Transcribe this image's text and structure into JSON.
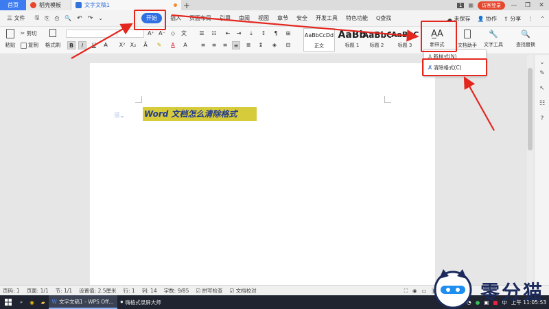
{
  "tabs": {
    "home": "首页",
    "template": "稻壳模板",
    "document": "文字文稿1",
    "new_tab": "+"
  },
  "titlebar": {
    "badge": "1",
    "visitor": "访客登录"
  },
  "menu": {
    "file": "三 文件",
    "items": [
      "开始",
      "插入",
      "页面布局",
      "引用",
      "审阅",
      "视图",
      "章节",
      "安全",
      "开发工具",
      "特色功能"
    ],
    "search": "Q查找",
    "unsaved": "未保存",
    "collab": "协作",
    "share": "分享"
  },
  "ribbon": {
    "paste": "粘贴",
    "cut": "剪切",
    "copy": "复制",
    "format_painter": "格式刷",
    "bold": "B",
    "italic": "I",
    "underline": "U",
    "font_color": "A",
    "styles": [
      {
        "preview": "AaBbCcDd",
        "label": "正文"
      },
      {
        "preview": "AaBb",
        "label": "标题 1"
      },
      {
        "preview": "AaBbC",
        "label": "标题 2"
      },
      {
        "preview": "AaBbC",
        "label": "标题 3"
      }
    ],
    "new_style": "新样式",
    "doc_assistant": "文档助手",
    "word_tools": "文字工具",
    "find_replace": "查找替换"
  },
  "dropdown": {
    "new_style_item": "新样式(N)",
    "clear_format_item": "清除格式(C)"
  },
  "document": {
    "title": "Word 文档怎么清除格式"
  },
  "statusbar": {
    "page_no": "页码: 1",
    "pages": "页面: 1/1",
    "section": "节: 1/1",
    "setting": "设置值: 2.5厘米",
    "row": "行: 1",
    "col": "列: 14",
    "words": "字数: 9/85",
    "spellcheck": "拼写检查",
    "proofread": "文档校对"
  },
  "taskbar": {
    "wps": "文字文稿1 - WPS Off...",
    "recorder": "嗨格式录屏大师",
    "ime": "中",
    "time": "上午 11:05:53"
  },
  "watermark": {
    "text": "零分猫"
  },
  "colors": {
    "accent": "#2f6fe4",
    "highlight_box": "#e3261e",
    "doc_title_bg": "#d6cb3b",
    "doc_title_fg": "#233a8f"
  }
}
